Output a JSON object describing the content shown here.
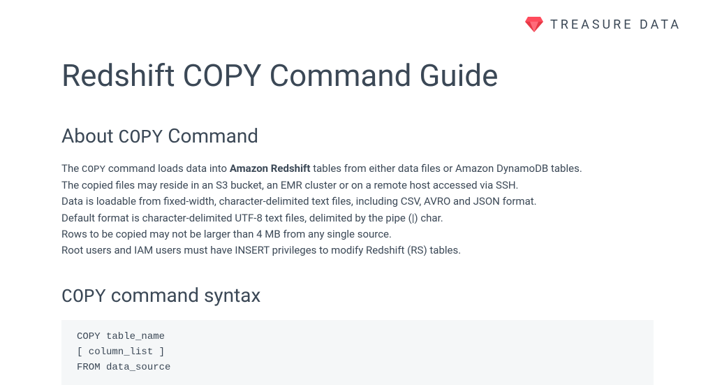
{
  "header": {
    "brand_name": "TREASURE DATA"
  },
  "page": {
    "title": "Redshift COPY Command Guide"
  },
  "about": {
    "heading_prefix": "About ",
    "heading_code": "COPY",
    "heading_suffix": " Command",
    "line1_a": "The ",
    "line1_code": "COPY",
    "line1_b": " command loads data into ",
    "line1_bold": "Amazon Redshift",
    "line1_c": " tables from either data files or Amazon DynamoDB tables.",
    "line2": "The copied files may reside in an S3 bucket, an EMR cluster or on a remote host accessed via SSH.",
    "line3": "Data is loadable from fixed-width, character-delimited text files, including CSV,  AVRO and JSON format.",
    "line4": "Default format is character-delimited UTF-8 text files, delimited by the pipe (|) char.",
    "line5": "Rows to be copied may not be larger than 4 MB from any single source.",
    "line6": "Root users and IAM users must have INSERT privileges to modify Redshift (RS) tables."
  },
  "syntax": {
    "heading_code": "COPY",
    "heading_suffix": " command syntax",
    "code": "COPY table_name\n[ column_list ]\nFROM data_source"
  }
}
